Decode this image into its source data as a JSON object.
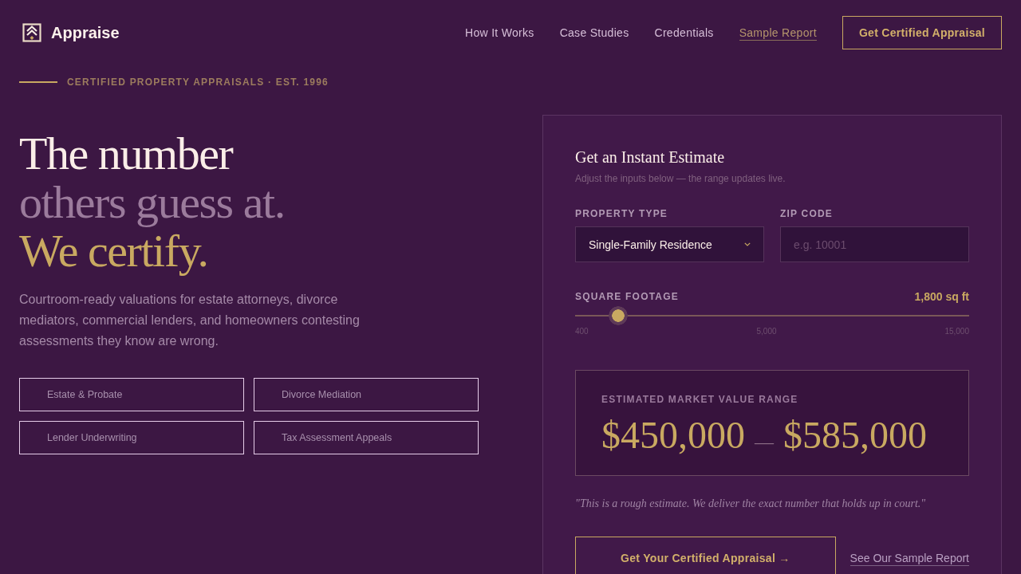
{
  "header": {
    "brand": "Appraise",
    "nav": [
      {
        "label": "How It Works",
        "selected": false
      },
      {
        "label": "Case Studies",
        "selected": false
      },
      {
        "label": "Credentials",
        "selected": false
      },
      {
        "label": "Sample Report",
        "selected": true
      }
    ],
    "cta": "Get Certified Appraisal"
  },
  "hero": {
    "eyebrow": "CERTIFIED PROPERTY APPRAISALS · EST. 1996",
    "headline": [
      {
        "text": "The number",
        "kind": "primary"
      },
      {
        "text": "others guess at.",
        "kind": "muted"
      },
      {
        "text": "We certify.",
        "kind": "accent"
      }
    ],
    "description": "Courtroom-ready valuations for estate attorneys, divorce mediators, commercial lenders, and homeowners contesting assessments they know are wrong.",
    "practice_areas": [
      "Estate & Probate",
      "Divorce Mediation",
      "Lender Underwriting",
      "Tax Assessment Appeals"
    ]
  },
  "estimate_card": {
    "title": "Get an Instant Estimate",
    "subtitle": "Adjust the inputs below — the range updates live.",
    "property_type": {
      "label": "PROPERTY TYPE",
      "value": "Single-Family Residence"
    },
    "zip_code": {
      "label": "ZIP CODE",
      "placeholder": "e.g. 10001"
    },
    "square_footage": {
      "label": "SQUARE FOOTAGE",
      "reading": "1,800 sq ft",
      "level": 0.11,
      "ticks": [
        "400",
        "5,000",
        "15,000"
      ]
    },
    "result": {
      "label": "ESTIMATED MARKET VALUE RANGE",
      "low": "$450,000",
      "separator": "—",
      "high": "$585,000"
    },
    "disclaimer": "\"This is a rough estimate. We deliver the exact number that holds up in court.\"",
    "primary_action": "Get Your Certified Appraisal →",
    "secondary_link": "See Our Sample Report"
  }
}
